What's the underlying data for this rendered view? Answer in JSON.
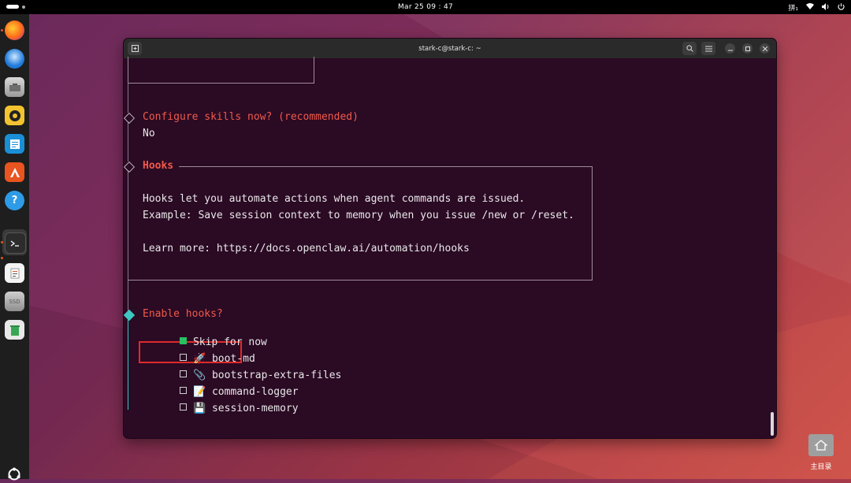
{
  "topbar": {
    "clock": "Mar 25  09 : 47",
    "input_method": "拼₁",
    "icons": [
      "wifi-icon",
      "volume-icon",
      "power-icon"
    ]
  },
  "dock": {
    "apps": [
      "firefox-icon",
      "thunderbird-icon",
      "files-icon",
      "rhythmbox-icon",
      "libreoffice-writer-icon",
      "app-center-icon",
      "help-icon",
      "terminal-icon",
      "text-editor-icon",
      "ssd-drive-icon",
      "trash-icon"
    ],
    "ssd_label": "SSD",
    "show_apps": "show-apps-icon"
  },
  "window": {
    "title": "stark-c@stark-c: ~"
  },
  "terminal": {
    "skills_prompt": "Configure skills now? (recommended)",
    "skills_answer": "No",
    "hooks_title": "Hooks",
    "hooks_desc_1": "Hooks let you automate actions when agent commands are issued.",
    "hooks_desc_2": "Example: Save session context to memory when you issue /new or /reset.",
    "hooks_learn": "Learn more: https://docs.openclaw.ai/automation/hooks",
    "enable_prompt": "Enable hooks?",
    "options": [
      {
        "label": "Skip for now",
        "emoji": "",
        "checked": true
      },
      {
        "label": "boot-md",
        "emoji": "🚀",
        "checked": false
      },
      {
        "label": "bootstrap-extra-files",
        "emoji": "📎",
        "checked": false
      },
      {
        "label": "command-logger",
        "emoji": "📝",
        "checked": false
      },
      {
        "label": "session-memory",
        "emoji": "💾",
        "checked": false
      }
    ]
  },
  "desktop": {
    "home_label": "主目录"
  },
  "colors": {
    "prompt_orange": "#f05a4a",
    "active_diamond": "#3ec6c0",
    "checked_box": "#27c062",
    "highlight_red": "#e02a2a"
  }
}
